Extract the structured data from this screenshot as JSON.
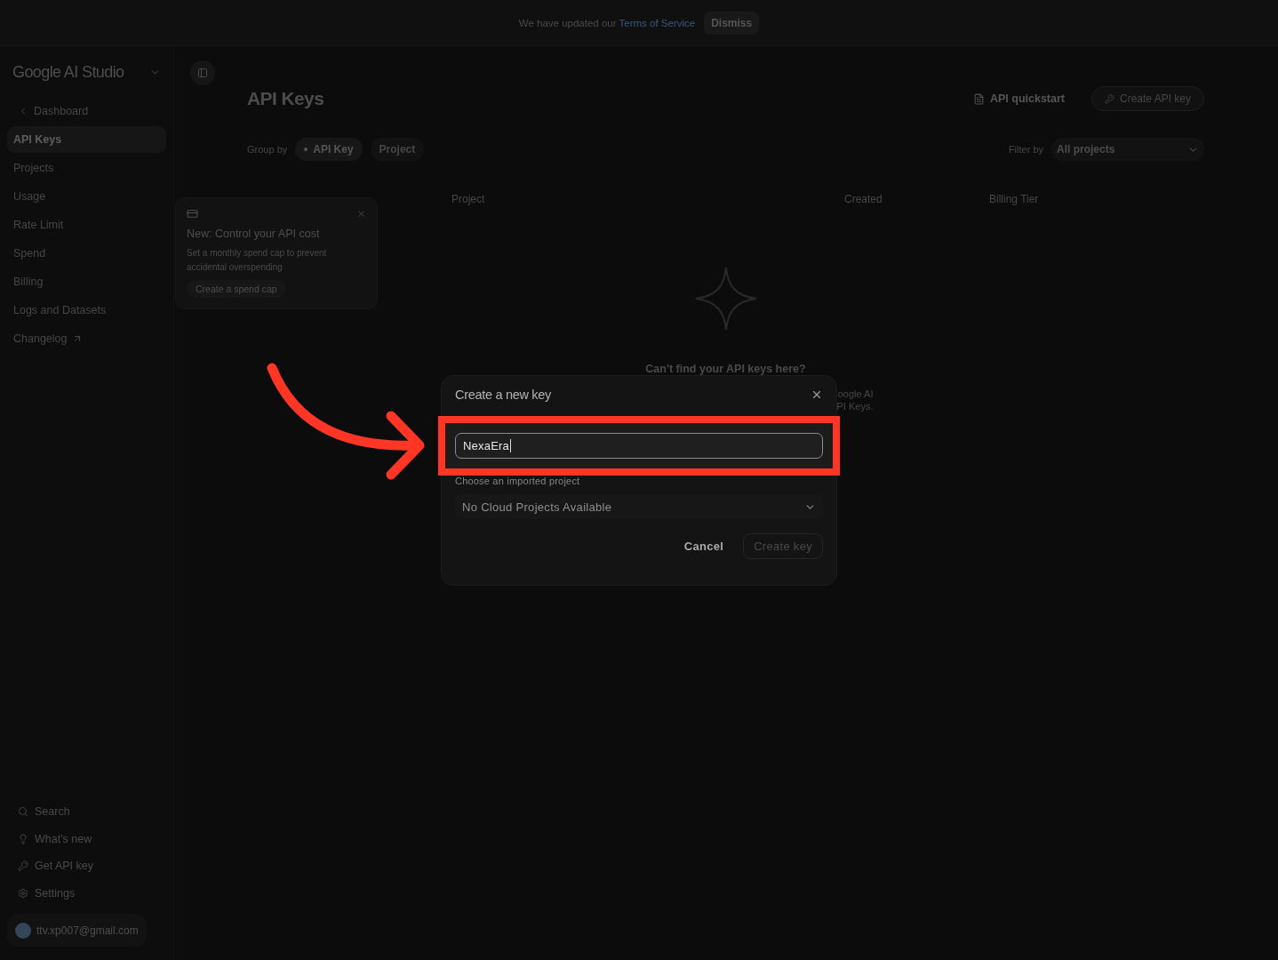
{
  "banner": {
    "message": "We have updated our",
    "link": "Terms of Service",
    "dismiss": "Dismiss"
  },
  "sidebar": {
    "brand": "Google AI Studio",
    "back": "Dashboard",
    "items": [
      {
        "label": "API Keys",
        "selected": true,
        "external": false
      },
      {
        "label": "Projects",
        "selected": false,
        "external": false
      },
      {
        "label": "Usage",
        "selected": false,
        "external": false
      },
      {
        "label": "Rate Limit",
        "selected": false,
        "external": false
      },
      {
        "label": "Spend",
        "selected": false,
        "external": false
      },
      {
        "label": "Billing",
        "selected": false,
        "external": false
      },
      {
        "label": "Logs and Datasets",
        "selected": false,
        "external": false
      },
      {
        "label": "Changelog",
        "selected": false,
        "external": true
      }
    ],
    "footer": [
      "Search",
      "What's new",
      "Get API key",
      "Settings"
    ],
    "account": "ttv.xp007@gmail.com"
  },
  "main": {
    "title": "API Keys",
    "quickstart": "API quickstart",
    "create_button": "Create API key",
    "group_by": {
      "label": "Group by",
      "options": [
        {
          "label": "API Key",
          "selected": true
        },
        {
          "label": "Project",
          "selected": false
        }
      ]
    },
    "filter": {
      "label": "Filter by",
      "value": "All projects"
    },
    "columns": [
      "Project",
      "Created",
      "Billing Tier"
    ],
    "empty_state": {
      "heading": "Can't find your API keys here?",
      "fragments": [
        "oogle AI",
        "PI Keys."
      ]
    }
  },
  "promo": {
    "title": "New: Control your API cost",
    "text": "Set a monthly spend cap to prevent accidental overspending",
    "button": "Create a spend cap"
  },
  "dialog": {
    "title": "Create a new key",
    "name_field": {
      "value": "NexaEra",
      "focused": true
    },
    "project_label": "Choose an imported project",
    "project_select": "No Cloud Projects Available",
    "buttons": [
      {
        "label": "Cancel",
        "kind": "text",
        "disabled": false
      },
      {
        "label": "Create key",
        "kind": "outline",
        "disabled": true
      }
    ]
  }
}
